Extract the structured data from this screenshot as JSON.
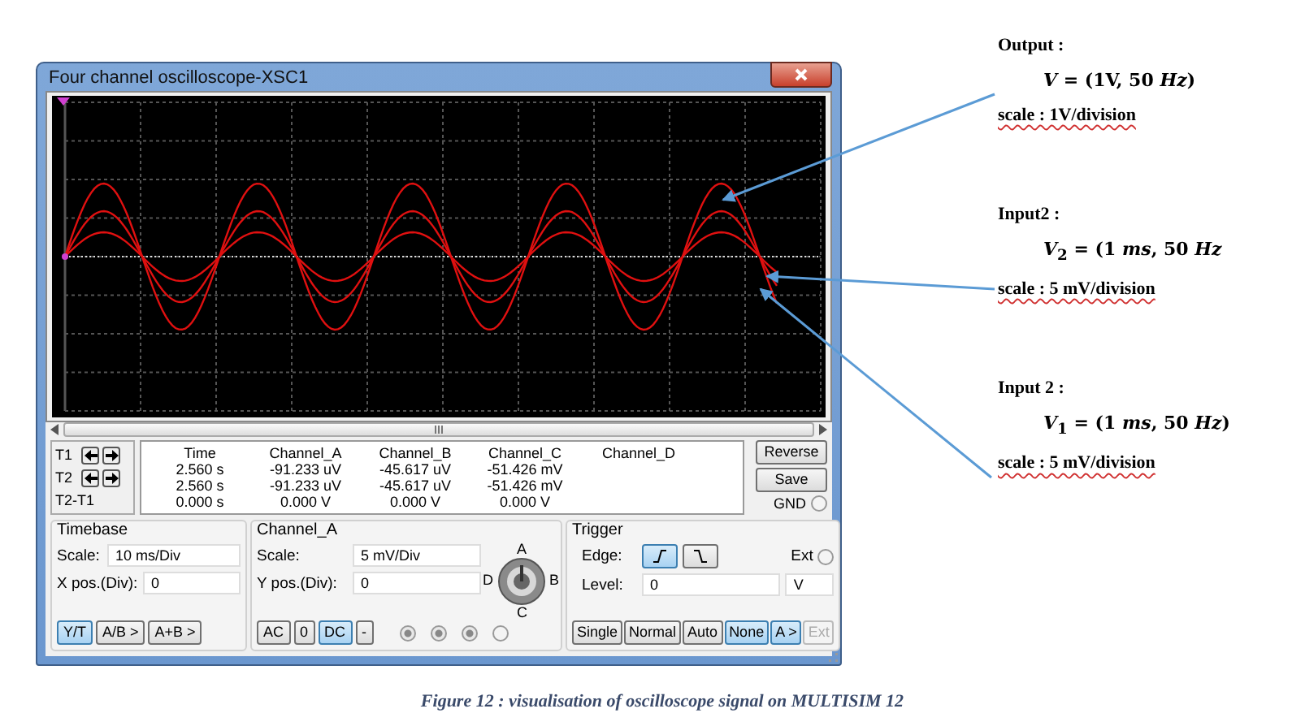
{
  "window": {
    "title": "Four channel oscilloscope-XSC1"
  },
  "cursor_panel": {
    "columns": [
      "Time",
      "Channel_A",
      "Channel_B",
      "Channel_C",
      "Channel_D"
    ],
    "rows": [
      {
        "label": "T1",
        "arrows": true,
        "values": [
          "2.560 s",
          "-91.233 uV",
          "-45.617 uV",
          "-51.426 mV"
        ]
      },
      {
        "label": "T2",
        "arrows": true,
        "values": [
          "2.560 s",
          "-91.233 uV",
          "-45.617 uV",
          "-51.426 mV"
        ]
      },
      {
        "label": "T2-T1",
        "arrows": false,
        "values": [
          "0.000 s",
          "0.000 V",
          "0.000 V",
          "0.000 V"
        ]
      }
    ],
    "buttons": [
      "Reverse",
      "Save"
    ],
    "gnd": {
      "label": "GND",
      "checked": false
    }
  },
  "timebase": {
    "title": "Timebase",
    "fields": [
      {
        "label": "Scale:",
        "value": "10 ms/Div"
      },
      {
        "label": "X pos.(Div):",
        "value": "0"
      }
    ],
    "buttons": [
      {
        "label": "Y/T",
        "selected": true
      },
      {
        "label": "A/B >",
        "selected": false
      },
      {
        "label": "A+B >",
        "selected": false
      }
    ]
  },
  "channel": {
    "title": "Channel_A",
    "fields": [
      {
        "label": "Scale:",
        "value": "5 mV/Div"
      },
      {
        "label": "Y pos.(Div):",
        "value": "0"
      }
    ],
    "knob_labels": [
      "A",
      "B",
      "C",
      "D"
    ],
    "coupling": [
      {
        "label": "AC",
        "selected": false
      },
      {
        "label": "0",
        "selected": false
      },
      {
        "label": "DC",
        "selected": true
      },
      {
        "label": "-",
        "selected": false
      }
    ],
    "radios": [
      {
        "checked": true
      },
      {
        "checked": true
      },
      {
        "checked": true
      },
      {
        "checked": false
      }
    ]
  },
  "trigger": {
    "title": "Trigger",
    "edge_label": "Edge:",
    "edges": [
      {
        "kind": "rising",
        "selected": true
      },
      {
        "kind": "falling",
        "selected": false
      }
    ],
    "ext": {
      "label": "Ext",
      "checked": false
    },
    "level_label": "Level:",
    "level_value": "0",
    "level_unit": "V",
    "buttons": [
      {
        "label": "Single",
        "selected": false,
        "disabled": false
      },
      {
        "label": "Normal",
        "selected": false,
        "disabled": false
      },
      {
        "label": "Auto",
        "selected": false,
        "disabled": false
      },
      {
        "label": "None",
        "selected": true,
        "disabled": false
      },
      {
        "label": "A >",
        "selected": true,
        "disabled": false
      },
      {
        "label": "Ext",
        "selected": false,
        "disabled": true
      }
    ]
  },
  "notes": [
    {
      "heading": "Output :",
      "formula": "*V* = (1V, 50 *Hz*)",
      "scale": "scale : 1V/division"
    },
    {
      "heading": "Input2 :",
      "formula": "*V*$_{2}$ = (1 *ms*, 50 *Hz*",
      "scale": "scale : 5 mV/division"
    },
    {
      "heading": "Input 2 :",
      "formula": "*V*$_{1}$ = (1 *ms*, 50 *Hz*)",
      "scale": "scale : 5 mV/division"
    }
  ],
  "caption": "Figure 12 : visualisation of oscilloscope signal on  MULTISIM 12"
}
